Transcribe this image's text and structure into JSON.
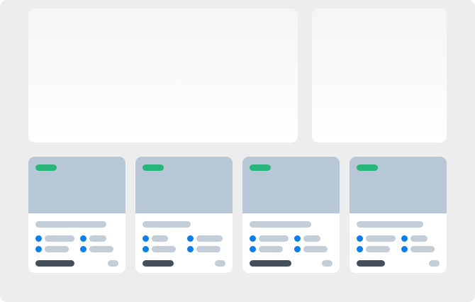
{
  "screen": {
    "description_free": true
  },
  "panels": [
    {
      "id": "hero",
      "content": ""
    },
    {
      "id": "side",
      "content": ""
    }
  ],
  "cards": [
    {
      "id": "card-1",
      "has_badge": true
    },
    {
      "id": "card-2",
      "has_badge": true
    },
    {
      "id": "card-3",
      "has_badge": true
    },
    {
      "id": "card-4",
      "has_badge": true
    }
  ],
  "colors": {
    "background": "#ededed",
    "panel": "#ffffff",
    "thumbnail": "#b8c7d6",
    "badge": "#28b67a",
    "placeholder": "#c3cdd7",
    "feature_dot": "#0a7ff2",
    "price_bar": "#454f5c"
  }
}
